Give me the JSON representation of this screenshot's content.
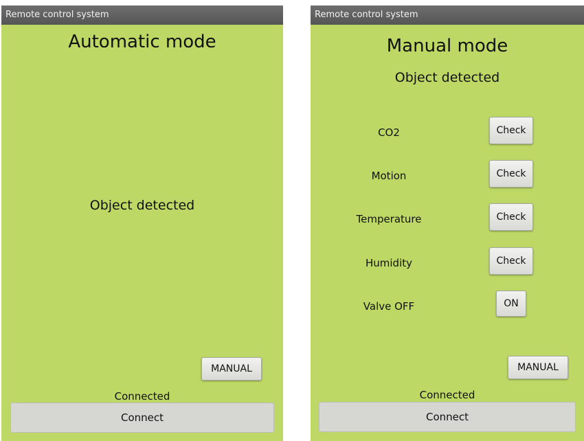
{
  "left_screen": {
    "app_title": "Remote control system",
    "mode_title": "Automatic mode",
    "status": "Object detected",
    "manual_button": "MANUAL",
    "connection_status": "Connected",
    "connect_button": "Connect"
  },
  "right_screen": {
    "app_title": "Remote control system",
    "mode_title": "Manual mode",
    "status": "Object detected",
    "sensors": [
      {
        "label": "CO2",
        "button": "Check"
      },
      {
        "label": "Motion",
        "button": "Check"
      },
      {
        "label": "Temperature",
        "button": "Check"
      },
      {
        "label": "Humidity",
        "button": "Check"
      }
    ],
    "valve": {
      "label": "Valve OFF",
      "button": "ON"
    },
    "manual_button": "MANUAL",
    "connection_status": "Connected",
    "connect_button": "Connect"
  },
  "colors": {
    "screen_background": "#bdd865",
    "titlebar": "#5f5f5f"
  }
}
